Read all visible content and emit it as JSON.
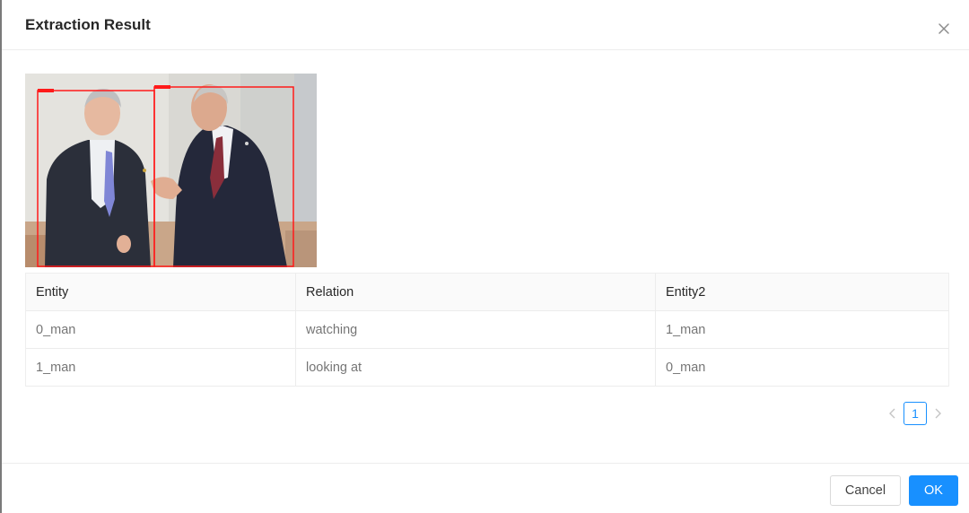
{
  "modal": {
    "title": "Extraction Result",
    "close_icon": "close-icon"
  },
  "image": {
    "boxes": [
      {
        "label": "0_man",
        "color": "#ff1a1a"
      },
      {
        "label": "1_man",
        "color": "#ff1a1a"
      }
    ]
  },
  "table": {
    "columns": [
      "Entity",
      "Relation",
      "Entity2"
    ],
    "rows": [
      [
        "0_man",
        "watching",
        "1_man"
      ],
      [
        "1_man",
        "looking at",
        "0_man"
      ]
    ]
  },
  "pagination": {
    "current_page": "1",
    "prev_icon": "chevron-left-icon",
    "next_icon": "chevron-right-icon"
  },
  "footer": {
    "cancel_label": "Cancel",
    "ok_label": "OK"
  },
  "colors": {
    "primary": "#1890ff",
    "box": "#ff1a1a"
  }
}
